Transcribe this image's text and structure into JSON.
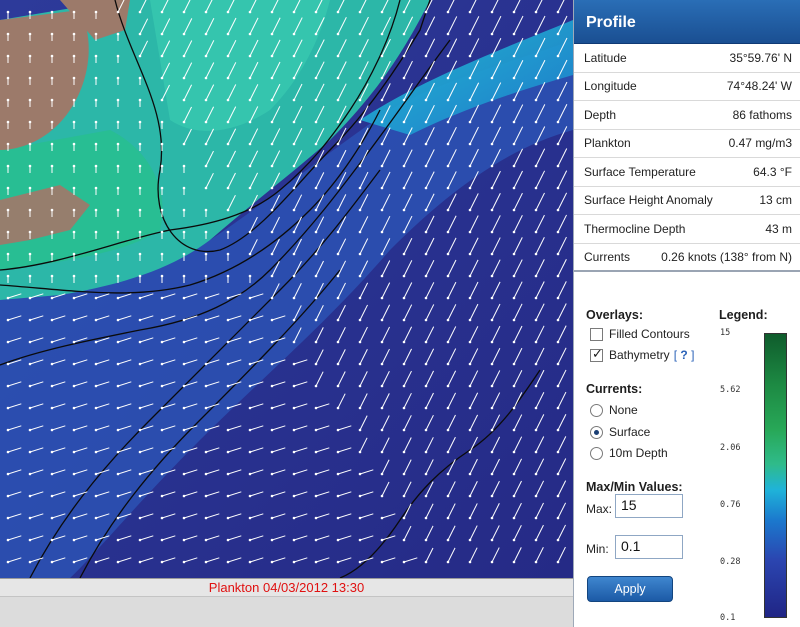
{
  "map": {
    "caption": "Plankton 04/03/2012 13:30"
  },
  "profile": {
    "title": "Profile",
    "rows": [
      {
        "label": "Latitude",
        "value": "35°59.76' N"
      },
      {
        "label": "Longitude",
        "value": "74°48.24' W"
      },
      {
        "label": "Depth",
        "value": "86 fathoms"
      },
      {
        "label": "Plankton",
        "value": "0.47 mg/m3"
      },
      {
        "label": "Surface Temperature",
        "value": "64.3 °F"
      },
      {
        "label": "Surface Height Anomaly",
        "value": "13 cm"
      },
      {
        "label": "Thermocline Depth",
        "value": "43 m"
      },
      {
        "label": "Currents",
        "value": "0.26 knots (138° from N)"
      }
    ]
  },
  "overlays": {
    "title": "Overlays:",
    "filled_contours": {
      "label": "Filled Contours",
      "checked": false
    },
    "bathymetry": {
      "label": "Bathymetry",
      "checked": true,
      "help_open": "[",
      "help_q": "?",
      "help_close": "]"
    }
  },
  "currents": {
    "title": "Currents:",
    "options": [
      {
        "label": "None",
        "selected": false
      },
      {
        "label": "Surface",
        "selected": true
      },
      {
        "label": "10m Depth",
        "selected": false
      }
    ]
  },
  "maxmin": {
    "title": "Max/Min Values:",
    "max_label": "Max:",
    "max_value": "15",
    "min_label": "Min:",
    "min_value": "0.1"
  },
  "apply_label": "Apply",
  "legend": {
    "title": "Legend:",
    "ticks": [
      "15",
      "5.62",
      "2.06",
      "0.76",
      "0.28",
      "0.1"
    ]
  },
  "colors": {
    "deep_water": "#2a2f8e",
    "shelf_water": "#1f86c8",
    "coastal_water": "#2fb6a0",
    "land": "#9c7a6a",
    "header_blue": "#1a4f92",
    "caption_red": "#e01010"
  }
}
